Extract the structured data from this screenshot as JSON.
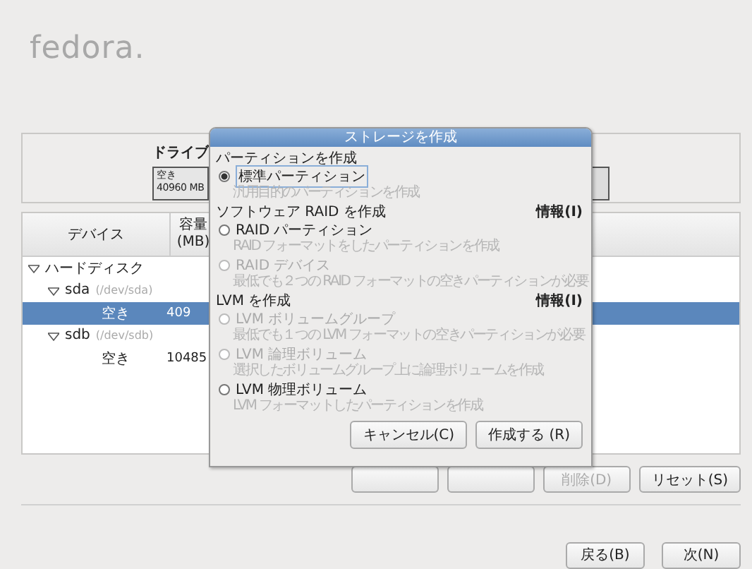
{
  "logo": "fedora.",
  "drive": {
    "label": "ドライブ",
    "segment_label": "空き",
    "segment_size": "40960 MB"
  },
  "table": {
    "columns": [
      "デバイス",
      "容量 (MB)"
    ],
    "rows": [
      {
        "name": "ハードディスク",
        "expanded": true,
        "selected": false,
        "children": [
          {
            "name": "sda",
            "path": "(/dev/sda)",
            "expanded": true,
            "selected": false,
            "children": [
              {
                "name": "空き",
                "size": "409",
                "selected": true
              }
            ]
          },
          {
            "name": "sdb",
            "path": "(/dev/sdb)",
            "expanded": true,
            "selected": false,
            "children": [
              {
                "name": "空き",
                "size": "10485",
                "selected": false
              }
            ]
          }
        ]
      }
    ]
  },
  "buttons": [
    {
      "kind": "covered"
    },
    {
      "kind": "covered"
    },
    {
      "kind": "normal",
      "label": "削除(D)",
      "disabled": true
    },
    {
      "kind": "normal",
      "label": "リセット(S)",
      "disabled": false
    }
  ],
  "nav": [
    "戻る(B)",
    "次(N)"
  ],
  "dialog": {
    "title": "ストレージを作成",
    "sections": [
      {
        "title": "パーティションを作成",
        "options": [
          {
            "label": "標準パーティション",
            "description": "汎用目的のパーティションを作成",
            "selected": true,
            "disabled": false
          }
        ]
      },
      {
        "title": "ソフトウェア RAID を作成",
        "info": "情報(I)",
        "options": [
          {
            "label": "RAID パーティション",
            "description": "RAID フォーマットをしたパーティションを作成",
            "selected": false,
            "disabled": false
          },
          {
            "label": "RAID デバイス",
            "description": "最低でも２つの RAID フォーマットの空きパーティションが必要",
            "selected": false,
            "disabled": true
          }
        ]
      },
      {
        "title": "LVM を作成",
        "info": "情報(I)",
        "options": [
          {
            "label": "LVM ボリュームグループ",
            "description": "最低でも１つの LVM フォーマットの空きパーティションが必要",
            "selected": false,
            "disabled": true
          },
          {
            "label": "LVM 論理ボリューム",
            "description": "選択したボリュームグループ上に論理ボリュームを作成",
            "selected": false,
            "disabled": true
          },
          {
            "label": "LVM 物理ボリューム",
            "description": "LVM フォーマットしたパーティションを作成",
            "selected": false,
            "disabled": false
          }
        ]
      }
    ],
    "buttons": [
      "キャンセル(C)",
      "作成する (R)"
    ]
  }
}
